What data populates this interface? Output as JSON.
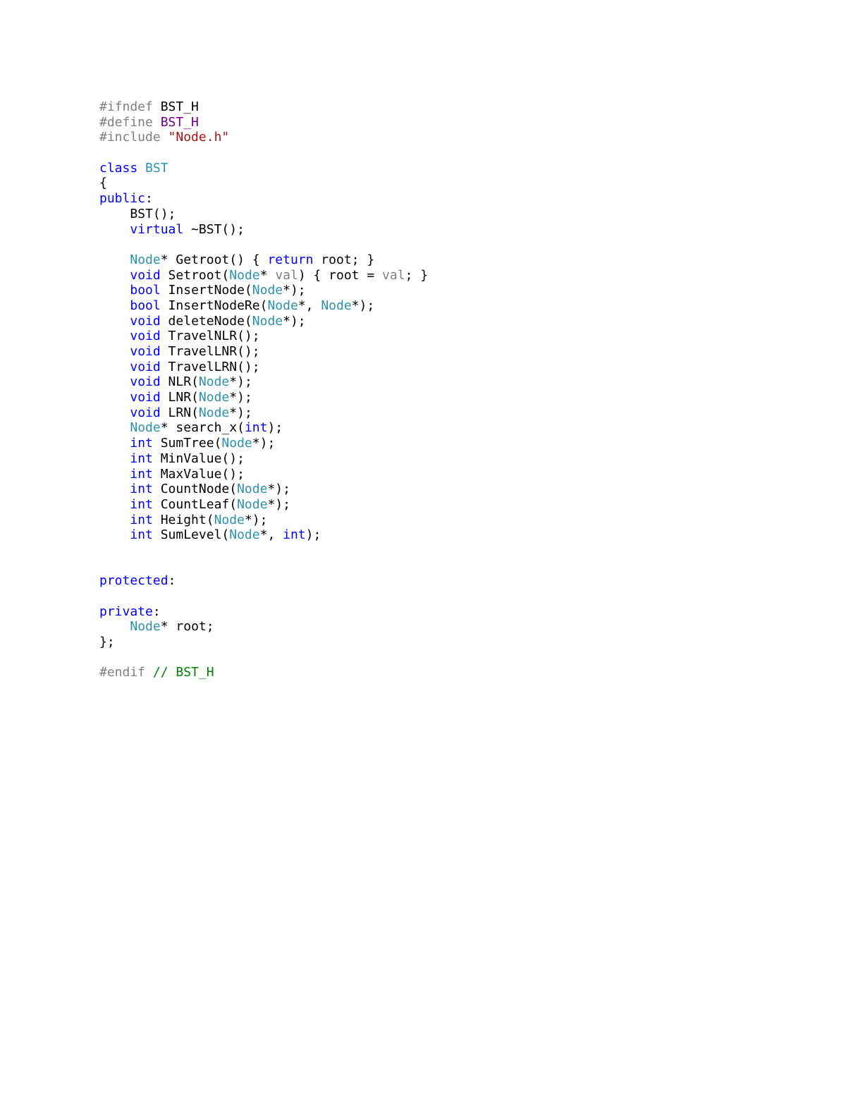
{
  "document": {
    "language": "C++",
    "colors": {
      "preprocessor": "#808080",
      "macro": "#6f008a",
      "string": "#a31515",
      "keyword": "#0000ff",
      "type": "#2b91af",
      "parameter": "#808080",
      "comment": "#008000",
      "plain": "#000000"
    },
    "lines": [
      [
        {
          "t": "#ifndef",
          "c": "pp"
        },
        {
          "t": " BST_H",
          "c": ""
        }
      ],
      [
        {
          "t": "#define",
          "c": "pp"
        },
        {
          "t": " ",
          "c": ""
        },
        {
          "t": "BST_H",
          "c": "macro"
        }
      ],
      [
        {
          "t": "#include",
          "c": "pp"
        },
        {
          "t": " ",
          "c": ""
        },
        {
          "t": "\"Node.h\"",
          "c": "str"
        }
      ],
      [],
      [
        {
          "t": "class",
          "c": "kw"
        },
        {
          "t": " ",
          "c": ""
        },
        {
          "t": "BST",
          "c": "type"
        }
      ],
      [
        {
          "t": "{",
          "c": ""
        }
      ],
      [
        {
          "t": "public",
          "c": "kw"
        },
        {
          "t": ":",
          "c": ""
        }
      ],
      [
        {
          "t": "    BST();",
          "c": ""
        }
      ],
      [
        {
          "t": "    ",
          "c": ""
        },
        {
          "t": "virtual",
          "c": "kw"
        },
        {
          "t": " ~BST();",
          "c": ""
        }
      ],
      [],
      [
        {
          "t": "    ",
          "c": ""
        },
        {
          "t": "Node",
          "c": "type"
        },
        {
          "t": "* Getroot() { ",
          "c": ""
        },
        {
          "t": "return",
          "c": "kw"
        },
        {
          "t": " root; }",
          "c": ""
        }
      ],
      [
        {
          "t": "    ",
          "c": ""
        },
        {
          "t": "void",
          "c": "kw"
        },
        {
          "t": " Setroot(",
          "c": ""
        },
        {
          "t": "Node",
          "c": "type"
        },
        {
          "t": "* ",
          "c": ""
        },
        {
          "t": "val",
          "c": "param"
        },
        {
          "t": ") { root = ",
          "c": ""
        },
        {
          "t": "val",
          "c": "param"
        },
        {
          "t": "; }",
          "c": ""
        }
      ],
      [
        {
          "t": "    ",
          "c": ""
        },
        {
          "t": "bool",
          "c": "kw"
        },
        {
          "t": " InsertNode(",
          "c": ""
        },
        {
          "t": "Node",
          "c": "type"
        },
        {
          "t": "*);",
          "c": ""
        }
      ],
      [
        {
          "t": "    ",
          "c": ""
        },
        {
          "t": "bool",
          "c": "kw"
        },
        {
          "t": " InsertNodeRe(",
          "c": ""
        },
        {
          "t": "Node",
          "c": "type"
        },
        {
          "t": "*, ",
          "c": ""
        },
        {
          "t": "Node",
          "c": "type"
        },
        {
          "t": "*);",
          "c": ""
        }
      ],
      [
        {
          "t": "    ",
          "c": ""
        },
        {
          "t": "void",
          "c": "kw"
        },
        {
          "t": " deleteNode(",
          "c": ""
        },
        {
          "t": "Node",
          "c": "type"
        },
        {
          "t": "*);",
          "c": ""
        }
      ],
      [
        {
          "t": "    ",
          "c": ""
        },
        {
          "t": "void",
          "c": "kw"
        },
        {
          "t": " TravelNLR();",
          "c": ""
        }
      ],
      [
        {
          "t": "    ",
          "c": ""
        },
        {
          "t": "void",
          "c": "kw"
        },
        {
          "t": " TravelLNR();",
          "c": ""
        }
      ],
      [
        {
          "t": "    ",
          "c": ""
        },
        {
          "t": "void",
          "c": "kw"
        },
        {
          "t": " TravelLRN();",
          "c": ""
        }
      ],
      [
        {
          "t": "    ",
          "c": ""
        },
        {
          "t": "void",
          "c": "kw"
        },
        {
          "t": " NLR(",
          "c": ""
        },
        {
          "t": "Node",
          "c": "type"
        },
        {
          "t": "*);",
          "c": ""
        }
      ],
      [
        {
          "t": "    ",
          "c": ""
        },
        {
          "t": "void",
          "c": "kw"
        },
        {
          "t": " LNR(",
          "c": ""
        },
        {
          "t": "Node",
          "c": "type"
        },
        {
          "t": "*);",
          "c": ""
        }
      ],
      [
        {
          "t": "    ",
          "c": ""
        },
        {
          "t": "void",
          "c": "kw"
        },
        {
          "t": " LRN(",
          "c": ""
        },
        {
          "t": "Node",
          "c": "type"
        },
        {
          "t": "*);",
          "c": ""
        }
      ],
      [
        {
          "t": "    ",
          "c": ""
        },
        {
          "t": "Node",
          "c": "type"
        },
        {
          "t": "* search_x(",
          "c": ""
        },
        {
          "t": "int",
          "c": "kw"
        },
        {
          "t": ");",
          "c": ""
        }
      ],
      [
        {
          "t": "    ",
          "c": ""
        },
        {
          "t": "int",
          "c": "kw"
        },
        {
          "t": " SumTree(",
          "c": ""
        },
        {
          "t": "Node",
          "c": "type"
        },
        {
          "t": "*);",
          "c": ""
        }
      ],
      [
        {
          "t": "    ",
          "c": ""
        },
        {
          "t": "int",
          "c": "kw"
        },
        {
          "t": " MinValue();",
          "c": ""
        }
      ],
      [
        {
          "t": "    ",
          "c": ""
        },
        {
          "t": "int",
          "c": "kw"
        },
        {
          "t": " MaxValue();",
          "c": ""
        }
      ],
      [
        {
          "t": "    ",
          "c": ""
        },
        {
          "t": "int",
          "c": "kw"
        },
        {
          "t": " CountNode(",
          "c": ""
        },
        {
          "t": "Node",
          "c": "type"
        },
        {
          "t": "*);",
          "c": ""
        }
      ],
      [
        {
          "t": "    ",
          "c": ""
        },
        {
          "t": "int",
          "c": "kw"
        },
        {
          "t": " CountLeaf(",
          "c": ""
        },
        {
          "t": "Node",
          "c": "type"
        },
        {
          "t": "*);",
          "c": ""
        }
      ],
      [
        {
          "t": "    ",
          "c": ""
        },
        {
          "t": "int",
          "c": "kw"
        },
        {
          "t": " Height(",
          "c": ""
        },
        {
          "t": "Node",
          "c": "type"
        },
        {
          "t": "*);",
          "c": ""
        }
      ],
      [
        {
          "t": "    ",
          "c": ""
        },
        {
          "t": "int",
          "c": "kw"
        },
        {
          "t": " SumLevel(",
          "c": ""
        },
        {
          "t": "Node",
          "c": "type"
        },
        {
          "t": "*, ",
          "c": ""
        },
        {
          "t": "int",
          "c": "kw"
        },
        {
          "t": ");",
          "c": ""
        }
      ],
      [],
      [],
      [
        {
          "t": "protected",
          "c": "kw"
        },
        {
          "t": ":",
          "c": ""
        }
      ],
      [],
      [
        {
          "t": "private",
          "c": "kw"
        },
        {
          "t": ":",
          "c": ""
        }
      ],
      [
        {
          "t": "    ",
          "c": ""
        },
        {
          "t": "Node",
          "c": "type"
        },
        {
          "t": "* root;",
          "c": ""
        }
      ],
      [
        {
          "t": "};",
          "c": ""
        }
      ],
      [],
      [
        {
          "t": "#endif",
          "c": "pp"
        },
        {
          "t": " ",
          "c": ""
        },
        {
          "t": "// BST_H",
          "c": "cmt"
        }
      ]
    ]
  }
}
